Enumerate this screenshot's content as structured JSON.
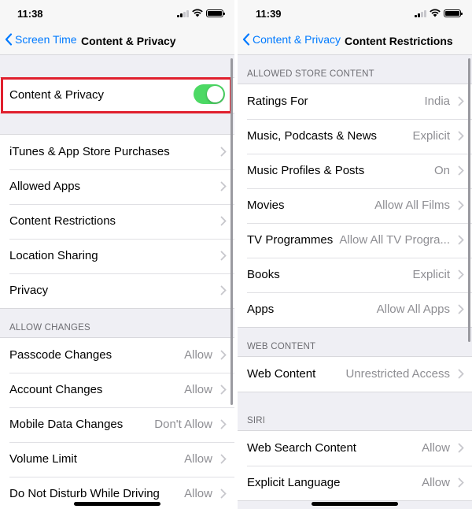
{
  "colors": {
    "accent": "#007aff",
    "toggle_on": "#4cd964",
    "highlight": "#e0202e",
    "secondary_text": "#8e8e93"
  },
  "left": {
    "status": {
      "time": "11:38"
    },
    "nav": {
      "back_label": "Screen Time",
      "title": "Content & Privacy"
    },
    "toggle_row": {
      "label": "Content & Privacy",
      "enabled": true
    },
    "menu_items": [
      {
        "label": "iTunes & App Store Purchases"
      },
      {
        "label": "Allowed Apps"
      },
      {
        "label": "Content Restrictions"
      },
      {
        "label": "Location Sharing"
      },
      {
        "label": "Privacy"
      }
    ],
    "allow_changes": {
      "header": "ALLOW CHANGES",
      "items": [
        {
          "label": "Passcode Changes",
          "value": "Allow"
        },
        {
          "label": "Account Changes",
          "value": "Allow"
        },
        {
          "label": "Mobile Data Changes",
          "value": "Don't Allow"
        },
        {
          "label": "Volume Limit",
          "value": "Allow"
        },
        {
          "label": "Do Not Disturb While Driving",
          "value": "Allow"
        }
      ]
    }
  },
  "right": {
    "status": {
      "time": "11:39"
    },
    "nav": {
      "back_label": "Content & Privacy",
      "title": "Content Restrictions"
    },
    "store": {
      "header": "ALLOWED STORE CONTENT",
      "items": [
        {
          "label": "Ratings For",
          "value": "India"
        },
        {
          "label": "Music, Podcasts & News",
          "value": "Explicit"
        },
        {
          "label": "Music Profiles & Posts",
          "value": "On"
        },
        {
          "label": "Movies",
          "value": "Allow All Films"
        },
        {
          "label": "TV Programmes",
          "value": "Allow All TV Progra..."
        },
        {
          "label": "Books",
          "value": "Explicit"
        },
        {
          "label": "Apps",
          "value": "Allow All Apps"
        }
      ]
    },
    "web": {
      "header": "WEB CONTENT",
      "items": [
        {
          "label": "Web Content",
          "value": "Unrestricted Access"
        }
      ]
    },
    "siri": {
      "header": "SIRI",
      "items": [
        {
          "label": "Web Search Content",
          "value": "Allow"
        },
        {
          "label": "Explicit Language",
          "value": "Allow"
        }
      ]
    }
  }
}
